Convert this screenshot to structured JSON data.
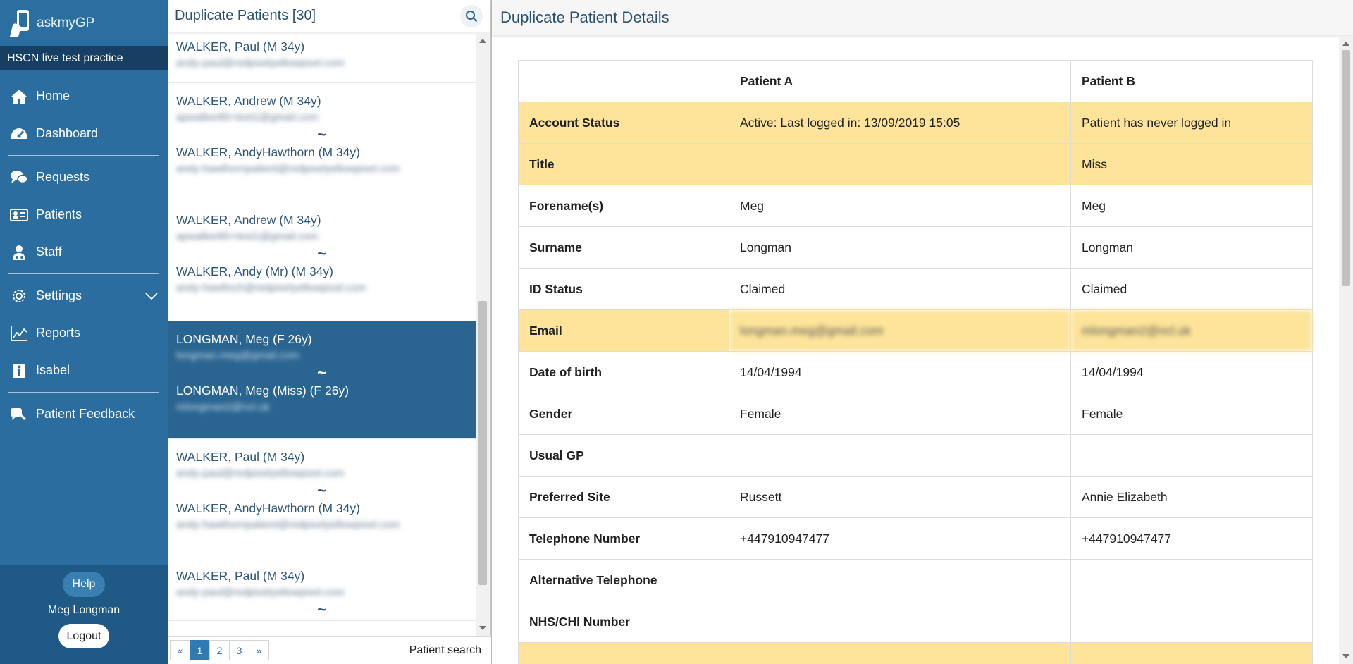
{
  "app": {
    "logo_text": "askmyGP",
    "practice": "HSCN live test practice"
  },
  "sidebar": {
    "items": [
      {
        "label": "Home",
        "icon": "home-icon"
      },
      {
        "label": "Dashboard",
        "icon": "dashboard-icon"
      },
      {
        "label": "Requests",
        "icon": "chat-icon"
      },
      {
        "label": "Patients",
        "icon": "id-card-icon"
      },
      {
        "label": "Staff",
        "icon": "staff-icon"
      },
      {
        "label": "Settings",
        "icon": "gear-icon"
      },
      {
        "label": "Reports",
        "icon": "chart-icon"
      },
      {
        "label": "Isabel",
        "icon": "info-icon"
      },
      {
        "label": "Patient Feedback",
        "icon": "feedback-icon"
      }
    ],
    "help_label": "Help",
    "user_name": "Meg Longman",
    "logout_label": "Logout"
  },
  "list": {
    "title": "Duplicate Patients [30]",
    "groups": [
      {
        "a_name": "WALKER, Paul (M 34y)",
        "a_email": "andy-paul@redpixelyellowpixel.com"
      },
      {
        "a_name": "WALKER, Andrew (M 34y)",
        "a_email": "apwalker85+test1@gmail.com",
        "b_name": "WALKER, AndyHawthorn (M 34y)",
        "b_email": "andy-hawthornpatient@redpixelyellowpixel.com"
      },
      {
        "a_name": "WALKER, Andrew (M 34y)",
        "a_email": "apwalker85+test1@gmail.com",
        "b_name": "WALKER, Andy (Mr) (M 34y)",
        "b_email": "andy-hawfinch@redpixelyellowpixel.com"
      },
      {
        "a_name": "LONGMAN, Meg (F 26y)",
        "a_email": "longman.meg@gmail.com",
        "b_name": "LONGMAN, Meg (Miss) (F 26y)",
        "b_email": "mlongman2@ncl.uk"
      },
      {
        "a_name": "WALKER, Paul (M 34y)",
        "a_email": "andy-paul@redpixelyellowpixel.com",
        "b_name": "WALKER, AndyHawthorn (M 34y)",
        "b_email": "andy-hawthornpatient@redpixelyellowpixel.com"
      },
      {
        "a_name": "WALKER, Paul (M 34y)",
        "a_email": "andy-paul@redpixelyellowpixel.com"
      }
    ],
    "separator": "~",
    "pager": {
      "prev": "«",
      "pages": [
        "1",
        "2",
        "3"
      ],
      "next": "»",
      "search_label": "Patient search"
    }
  },
  "detail": {
    "title": "Duplicate Patient Details",
    "col_a": "Patient A",
    "col_b": "Patient B",
    "rows": [
      {
        "label": "Account Status",
        "a": "Active: Last logged in: 13/09/2019 15:05",
        "b": "Patient has never logged in"
      },
      {
        "label": "Title",
        "a": "",
        "b": "Miss"
      },
      {
        "label": "Forename(s)",
        "a": "Meg",
        "b": "Meg"
      },
      {
        "label": "Surname",
        "a": "Longman",
        "b": "Longman"
      },
      {
        "label": "ID Status",
        "a": "Claimed",
        "b": "Claimed"
      },
      {
        "label": "Email",
        "a": "longman.meg@gmail.com",
        "b": "mlongman2@ncl.uk"
      },
      {
        "label": "Date of birth",
        "a": "14/04/1994",
        "b": "14/04/1994"
      },
      {
        "label": "Gender",
        "a": "Female",
        "b": "Female"
      },
      {
        "label": "Usual GP",
        "a": "",
        "b": ""
      },
      {
        "label": "Preferred Site",
        "a": "Russett",
        "b": "Annie Elizabeth"
      },
      {
        "label": "Telephone Number",
        "a": "+447910947477",
        "b": "+447910947477"
      },
      {
        "label": "Alternative Telephone",
        "a": "",
        "b": ""
      },
      {
        "label": "NHS/CHI Number",
        "a": "",
        "b": ""
      },
      {
        "label": "",
        "a": "",
        "b": ""
      }
    ]
  },
  "colors": {
    "sidebar": "#2a6d9e",
    "selected": "#2a6591",
    "highlight": "#fde49a"
  }
}
